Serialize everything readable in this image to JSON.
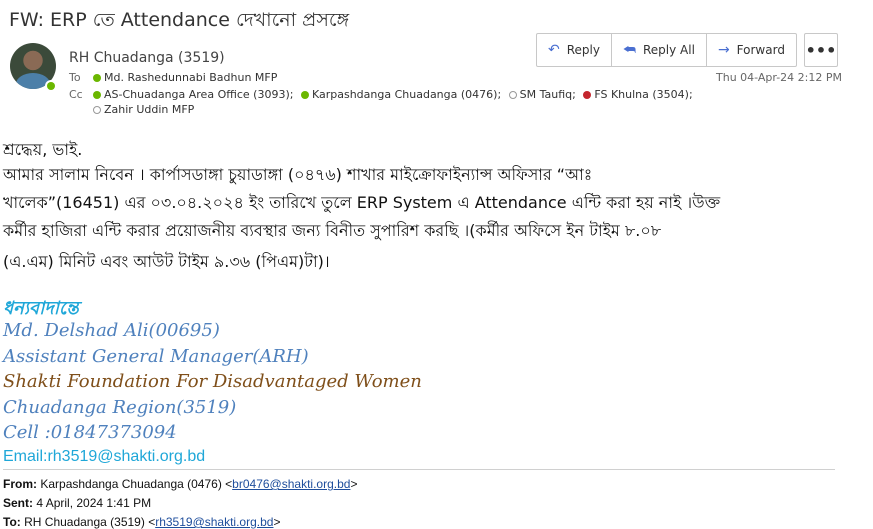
{
  "subject": "FW: ERP তে Attendance দেখানো প্রসঙ্গে",
  "sender": "RH Chuadanga (3519)",
  "to_label": "To",
  "cc_label": "Cc",
  "to": [
    {
      "name": "Md. Rashedunnabi Badhun MFP",
      "presence": "available"
    }
  ],
  "cc": [
    {
      "name": "AS-Chuadanga Area Office (3093);",
      "presence": "available"
    },
    {
      "name": "Karpashdanga Chuadanga (0476);",
      "presence": "available"
    },
    {
      "name": "SM Taufiq;",
      "presence": "offline"
    },
    {
      "name": "FS Khulna (3504);",
      "presence": "busy"
    },
    {
      "name": "Zahir Uddin MFP",
      "presence": "offline"
    }
  ],
  "actions": {
    "reply": "Reply",
    "reply_all": "Reply All",
    "forward": "Forward",
    "more": "•••"
  },
  "date": "Thu 04-Apr-24 2:12 PM",
  "body": {
    "greeting": "শ্রদ্ধেয়,  ভাই.",
    "line1": "আমার সালাম নিবেন । কার্পাসডাঙ্গা চুয়াডাঙ্গা (০৪৭৬) শাখার মাইক্রোফাইন্যান্স অফিসার “আঃ",
    "line2": "খালেক”(16451) এর ০৩.০৪.২০২৪ ইং তারিখে  তুলে ERP System এ Attendance এন্টি করা হয় নাই ।উক্ত",
    "line3": "কর্মীর হাজিরা এন্টি করার প্রয়োজনীয় ব্যবস্থার জন্য বিনীত সুপারিশ করছি ।(কর্মীর অফিসে ইন টাইম ৮.০৮",
    "line4": "(এ.এম) মিনিট এবং আউট টাইম ৯.৩৬ (পিএম)টা)।"
  },
  "signature": {
    "thanks": "ধন্যবাদান্তে",
    "name": "Md. Delshad Ali(00695)",
    "title": "Assistant General Manager(ARH)",
    "org": "Shakti Foundation For Disadvantaged Women",
    "region": "Chuadanga Region(3519)",
    "cell": "Cell :01847373094",
    "email": "Email:rh3519@shakti.org.bd"
  },
  "forwarded": {
    "from_label": "From:",
    "from_name": "Karpashdanga Chuadanga (0476) <",
    "from_email": "br0476@shakti.org.bd",
    "from_end": ">",
    "sent_label": "Sent:",
    "sent": "4 April, 2024 1:41 PM",
    "to_label": "To:",
    "to_name": "RH Chuadanga (3519) <",
    "to_email": "rh3519@shakti.org.bd",
    "to_end": ">"
  },
  "colors": {
    "accent": "#4a6fd1",
    "available": "#6bb700",
    "busy": "#c4262e",
    "signature_blue": "#4f81bd",
    "signature_cyan": "#1fa7d8",
    "signature_brown": "#7f4f1a"
  }
}
